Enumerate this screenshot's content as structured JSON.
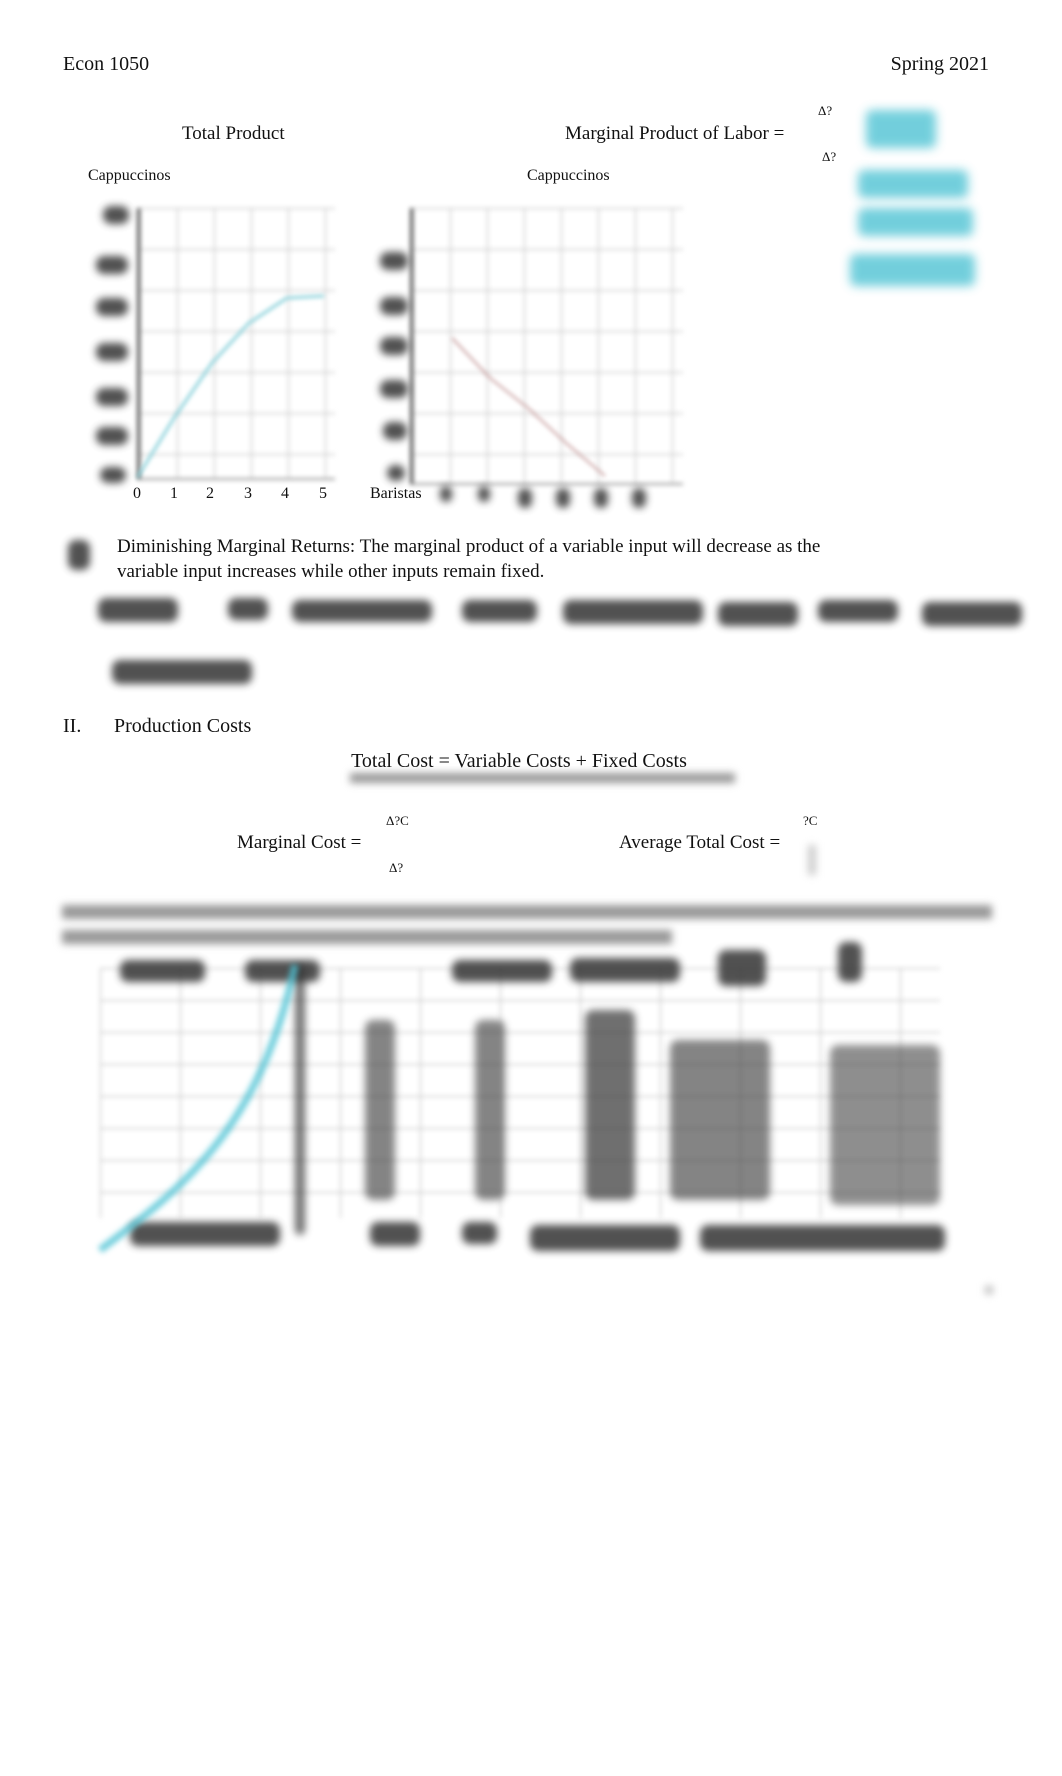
{
  "header": {
    "course": "Econ 1050",
    "term": "Spring 2021"
  },
  "charts": {
    "total_product": {
      "title": "Total Product",
      "y_label": "Cappuccinos",
      "x_ticks": [
        "0",
        "1",
        "2",
        "3",
        "4",
        "5"
      ]
    },
    "marginal_product": {
      "title": "Marginal Product of Labor =",
      "fraction_top": "Δ?",
      "fraction_bottom": "Δ?",
      "y_label": "Cappuccinos",
      "x_label": "Baristas"
    }
  },
  "definition": {
    "line1": "Diminishing Marginal Returns: The marginal product of a variable input will decrease as the",
    "line2": "variable input increases while other inputs remain fixed."
  },
  "section2": {
    "number": "II.",
    "title": "Production Costs",
    "total_cost_formula": "Total Cost = Variable Costs + Fixed Costs",
    "marginal_cost": {
      "label": "Marginal Cost =",
      "top": "Δ?C",
      "bottom": "Δ?"
    },
    "average_total_cost": {
      "label": "Average Total Cost =",
      "top": "?C"
    }
  },
  "colors": {
    "handwriting_accent": "#4fc3d4",
    "text": "#111111"
  }
}
